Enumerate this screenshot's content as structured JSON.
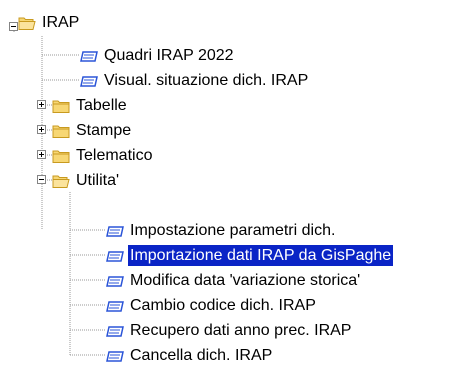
{
  "tree": {
    "root": {
      "label": "IRAP",
      "icon": "folder-open-icon",
      "expanded": true
    },
    "children": [
      {
        "label": "Quadri IRAP 2022",
        "icon": "form-icon"
      },
      {
        "label": "Visual. situazione dich. IRAP",
        "icon": "form-icon"
      },
      {
        "label": "Tabelle",
        "icon": "folder-closed-icon",
        "expanded": false
      },
      {
        "label": "Stampe",
        "icon": "folder-closed-icon",
        "expanded": false
      },
      {
        "label": "Telematico",
        "icon": "folder-closed-icon",
        "expanded": false
      },
      {
        "label": "Utilita'",
        "icon": "folder-open-icon",
        "expanded": true,
        "children": [
          {
            "label": "Impostazione parametri dich.",
            "icon": "form-icon"
          },
          {
            "label": "Importazione dati IRAP da GisPaghe",
            "icon": "form-icon",
            "selected": true
          },
          {
            "label": "Modifica data 'variazione storica'",
            "icon": "form-icon"
          },
          {
            "label": "Cambio codice dich. IRAP",
            "icon": "form-icon"
          },
          {
            "label": "Recupero dati anno prec. IRAP",
            "icon": "form-icon"
          },
          {
            "label": "Cancella dich. IRAP",
            "icon": "form-icon"
          }
        ]
      }
    ]
  },
  "colors": {
    "selection_bg": "#0a24c6",
    "selection_text": "#ffffff",
    "folder_fill": "#f7d774",
    "folder_edge": "#c89a1f",
    "form_blue": "#2b55d8"
  }
}
